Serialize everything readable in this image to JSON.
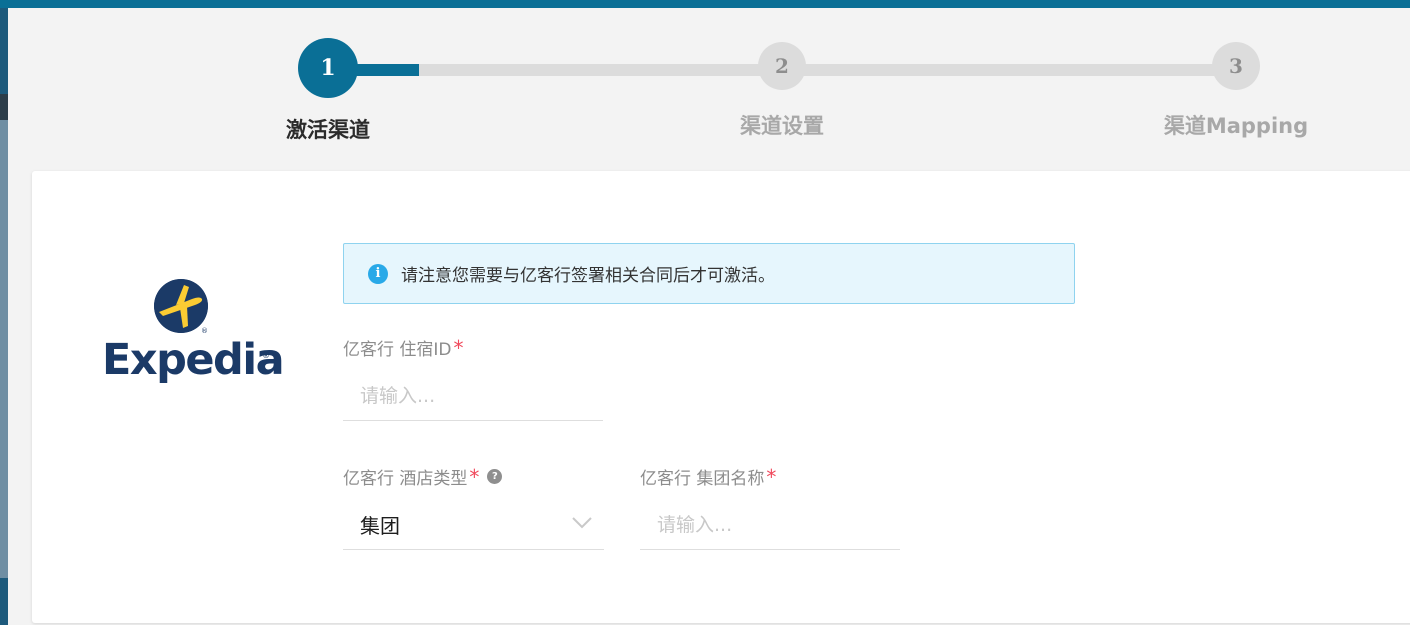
{
  "stepper": {
    "steps": [
      {
        "number": "1",
        "label": "激活渠道"
      },
      {
        "number": "2",
        "label": "渠道设置"
      },
      {
        "number": "3",
        "label": "渠道Mapping"
      }
    ],
    "current_step": 1
  },
  "logo": {
    "text": "Expedia"
  },
  "alert": {
    "icon": "info-icon",
    "text": "请注意您需要与亿客行签署相关合同后才可激活。"
  },
  "form": {
    "property_id": {
      "label": "亿客行 住宿ID",
      "required_mark": "*",
      "placeholder": "请输入..."
    },
    "hotel_type": {
      "label": "亿客行 酒店类型",
      "required_mark": "*",
      "help_icon": "question-icon",
      "value": "集团"
    },
    "group_name": {
      "label": "亿客行 集团名称",
      "required_mark": "*",
      "placeholder": "请输入..."
    }
  },
  "colors": {
    "primary": "#0a6f96",
    "step_inactive": "#dcdcdc",
    "alert_bg": "#e6f6fd",
    "alert_icon": "#29a9e8",
    "required": "#f0495c",
    "brand_navy": "#1b3a67",
    "brand_yellow": "#fbcc33"
  }
}
